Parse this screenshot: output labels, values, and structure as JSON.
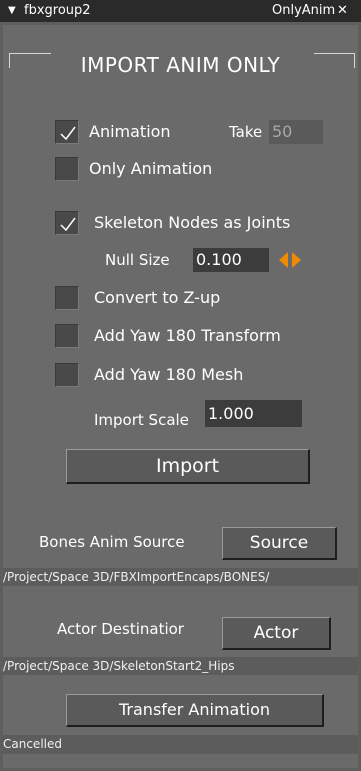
{
  "titlebar": {
    "arrow": "▼",
    "name": "fbxgroup2",
    "tab": "OnlyAnim",
    "close": "✕"
  },
  "heading": "IMPORT ANIM ONLY",
  "animation": {
    "label": "Animation",
    "checked": true,
    "take_label": "Take",
    "take_value": "50"
  },
  "only_animation": {
    "label": "Only Animation",
    "checked": false
  },
  "skeleton_joints": {
    "label": "Skeleton Nodes as Joints",
    "checked": true
  },
  "null_size": {
    "label": "Null Size",
    "value": "0.100",
    "spinner_icon": "orange-arrows-icon"
  },
  "convert_zup": {
    "label": "Convert to Z-up",
    "checked": false
  },
  "yaw_transform": {
    "label": "Add Yaw 180 Transform",
    "checked": false
  },
  "yaw_mesh": {
    "label": "Add Yaw 180 Mesh",
    "checked": false
  },
  "import_scale": {
    "label": "Import Scale",
    "value": "1.000"
  },
  "import_button": "Import",
  "bones_source": {
    "label": "Bones Anim Source",
    "button": "Source",
    "path": "/Project/Space 3D/FBXImportEncaps/BONES/"
  },
  "actor_destination": {
    "label": "Actor Destinatior",
    "button": "Actor",
    "path": "/Project/Space 3D/SkeletonStart2_Hips"
  },
  "transfer_button": "Transfer Animation",
  "status": "Cancelled",
  "colors": {
    "spinner_accent": "#f08a00",
    "field_bg": "#3c3c3c",
    "panel_bg": "#6a6a6a"
  }
}
